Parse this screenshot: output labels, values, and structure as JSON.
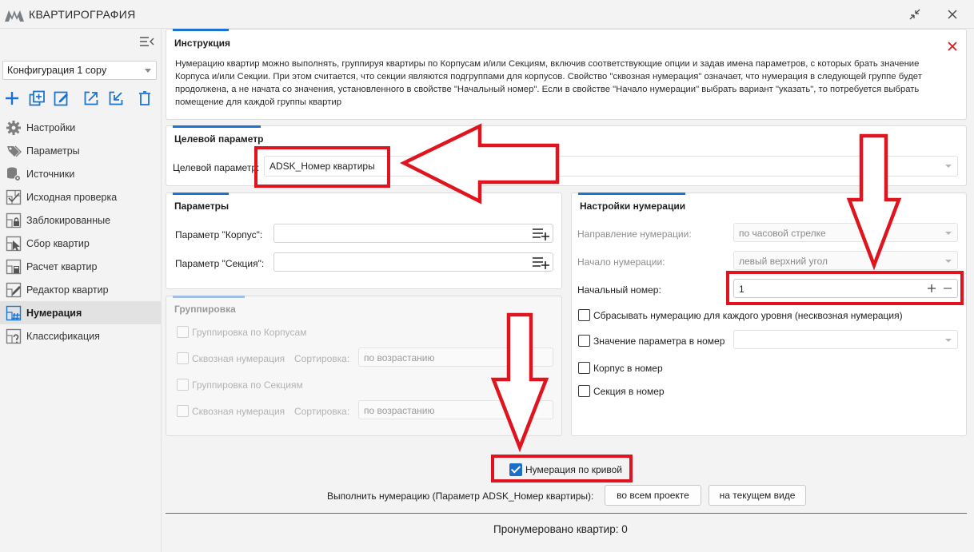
{
  "window": {
    "title": "КВАРТИРОГРАФИЯ",
    "icons": {
      "logo": "app-logo",
      "restore": "collapse-arrows-icon",
      "close": "close-icon"
    }
  },
  "sidebar": {
    "config_value": "Конфигурация 1 copy",
    "items": [
      {
        "label": "Настройки",
        "icon": "gear-icon"
      },
      {
        "label": "Параметры",
        "icon": "tag-icon"
      },
      {
        "label": "Источники",
        "icon": "database-gear-icon"
      },
      {
        "label": "Исходная проверка",
        "icon": "check-plan-icon"
      },
      {
        "label": "Заблокированные",
        "icon": "lock-plan-icon"
      },
      {
        "label": "Сбор квартир",
        "icon": "cursor-plan-icon"
      },
      {
        "label": "Расчет квартир",
        "icon": "calculator-plan-icon"
      },
      {
        "label": "Редактор квартир",
        "icon": "pencil-plan-icon"
      },
      {
        "label": "Нумерация",
        "icon": "hash-plan-icon",
        "active": true
      },
      {
        "label": "Классификация",
        "icon": "question-plan-icon"
      }
    ]
  },
  "instruction": {
    "title": "Инструкция",
    "text": "Нумерацию квартир можно выполнять, группируя квартиры по Корпусам и/или Секциям, включив соответствующие опции и задав имена параметров, с которых брать значение Корпуса и/или Секции. При этом считается, что секции являются подгруппами для корпусов. Свойство \"сквозная нумерация\" означает, что нумерация в следующей группе будет продолжена, а не начата со значения, установленного в свойстве \"Начальный номер\". Если в свойстве \"Начало нумерации\" выбрать вариант \"указать\", то потребуется выбрать помещение для каждой группы квартир"
  },
  "target": {
    "title": "Целевой параметр",
    "label": "Целевой параметр:",
    "value": "ADSK_Номер квартиры"
  },
  "params": {
    "title": "Параметры",
    "korpus_label": "Параметр \"Корпус\":",
    "korpus_value": "",
    "section_label": "Параметр \"Секция\":",
    "section_value": ""
  },
  "grouping": {
    "title": "Группировка",
    "by_korpus": "Группировка по Корпусам",
    "through1": "Сквозная нумерация",
    "sort1_label": "Сортировка:",
    "sort1_value": "по возрастанию",
    "by_section": "Группировка по Секциям",
    "through2": "Сквозная нумерация",
    "sort2_label": "Сортировка:",
    "sort2_value": "по возрастанию"
  },
  "numbering": {
    "title": "Настройки нумерации",
    "direction_label": "Направление нумерации:",
    "direction_value": "по часовой стрелке",
    "start_label": "Начало нумерации:",
    "start_value": "левый верхний угол",
    "start_num_label": "Начальный номер:",
    "start_num_value": "1",
    "reset_label": "Сбрасывать нумерацию для каждого уровня (несквозная нумерация)",
    "param_value_label": "Значение параметра в номер",
    "param_value_value": "",
    "korpus_in_num": "Корпус в номер",
    "section_in_num": "Секция в номер"
  },
  "footer": {
    "curve_label": "Нумерация по кривой",
    "run_label": "Выполнить нумерацию (Параметр ADSK_Номер квартиры):",
    "btn_all": "во всем проекте",
    "btn_view": "на текущем виде",
    "status": "Пронумеровано квартир: 0"
  },
  "colors": {
    "accent": "#1b73d1",
    "annotation_red": "#e0141e",
    "checkbox_blue": "#1b6ec9"
  }
}
